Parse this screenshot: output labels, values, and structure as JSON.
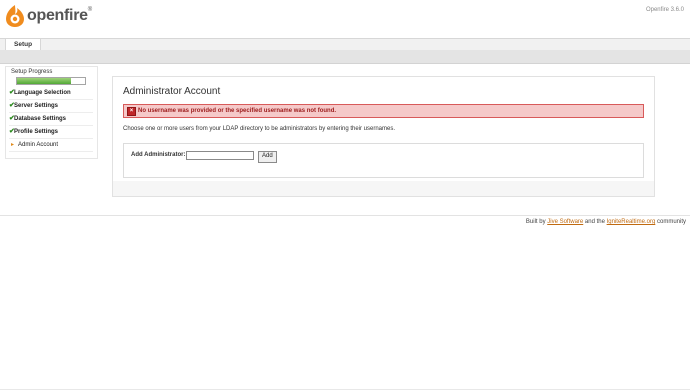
{
  "header": {
    "logo_text": "openfire",
    "logo_tm": "®",
    "version": "Openfire 3.6.0"
  },
  "tabs": [
    {
      "label": "Setup"
    }
  ],
  "sidebar": {
    "progress_label": "Setup Progress",
    "progress_fraction": 0.8,
    "items": [
      {
        "label": "Language Selection",
        "status": "complete"
      },
      {
        "label": "Server Settings",
        "status": "complete"
      },
      {
        "label": "Database Settings",
        "status": "complete"
      },
      {
        "label": "Profile Settings",
        "status": "complete"
      },
      {
        "label": "Admin Account",
        "status": "current"
      }
    ]
  },
  "main": {
    "title": "Administrator Account",
    "error": "No username was provided or the specified username was not found.",
    "instructions": "Choose one or more users from your LDAP directory to be administrators by entering their usernames.",
    "form": {
      "label": "Add Administrator:",
      "input_value": "",
      "button_label": "Add"
    }
  },
  "footer": {
    "prefix": "Built by ",
    "link1": "Jive Software",
    "middle": " and the ",
    "link2": "IgniteRealtime.org",
    "suffix": " community"
  },
  "colors": {
    "error_bg": "#f5c9c9",
    "error_text": "#9c1b1b",
    "progress_green": "#52a836",
    "link_orange": "#c06a10"
  }
}
